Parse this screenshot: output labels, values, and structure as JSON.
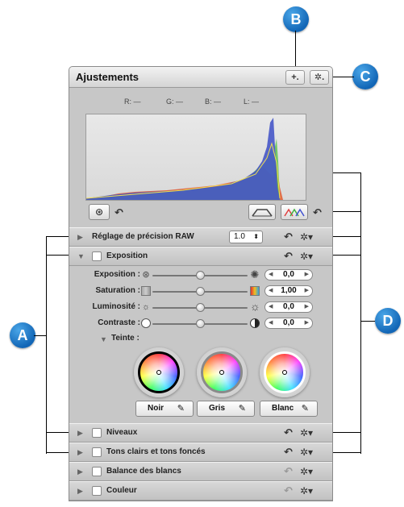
{
  "callouts": {
    "a": "A",
    "b": "B",
    "c": "C",
    "d": "D"
  },
  "header": {
    "title": "Ajustements",
    "add_label": "+.",
    "gear_label": "✲."
  },
  "histogram": {
    "readout": [
      {
        "label": "R: —"
      },
      {
        "label": "G: —"
      },
      {
        "label": "B: —"
      },
      {
        "label": "L: —"
      }
    ]
  },
  "raw": {
    "label": "Réglage de précision RAW",
    "value": "1.0",
    "arrows": "⬍"
  },
  "exposition_section": {
    "label": "Exposition"
  },
  "sliders": [
    {
      "label": "Exposition :",
      "value": "0,0"
    },
    {
      "label": "Saturation :",
      "value": "1,00"
    },
    {
      "label": "Luminosité :",
      "value": "0,0"
    },
    {
      "label": "Contraste :",
      "value": "0,0"
    }
  ],
  "teinte": {
    "label": "Teinte :"
  },
  "pickers": [
    {
      "label": "Noir"
    },
    {
      "label": "Gris"
    },
    {
      "label": "Blanc"
    }
  ],
  "sections": [
    {
      "label": "Niveaux"
    },
    {
      "label": "Tons clairs et tons foncés"
    },
    {
      "label": "Balance des blancs"
    },
    {
      "label": "Couleur"
    }
  ],
  "icons": {
    "undo": "↶",
    "gear": "✲▾",
    "triangle_right": "▶",
    "triangle_down": "▼",
    "eyedropper": "✎",
    "arrow_left": "◀",
    "arrow_right": "▶"
  },
  "colors": {
    "callout_blue": "#1a73c2",
    "panel_gray": "#c7c7c7"
  }
}
